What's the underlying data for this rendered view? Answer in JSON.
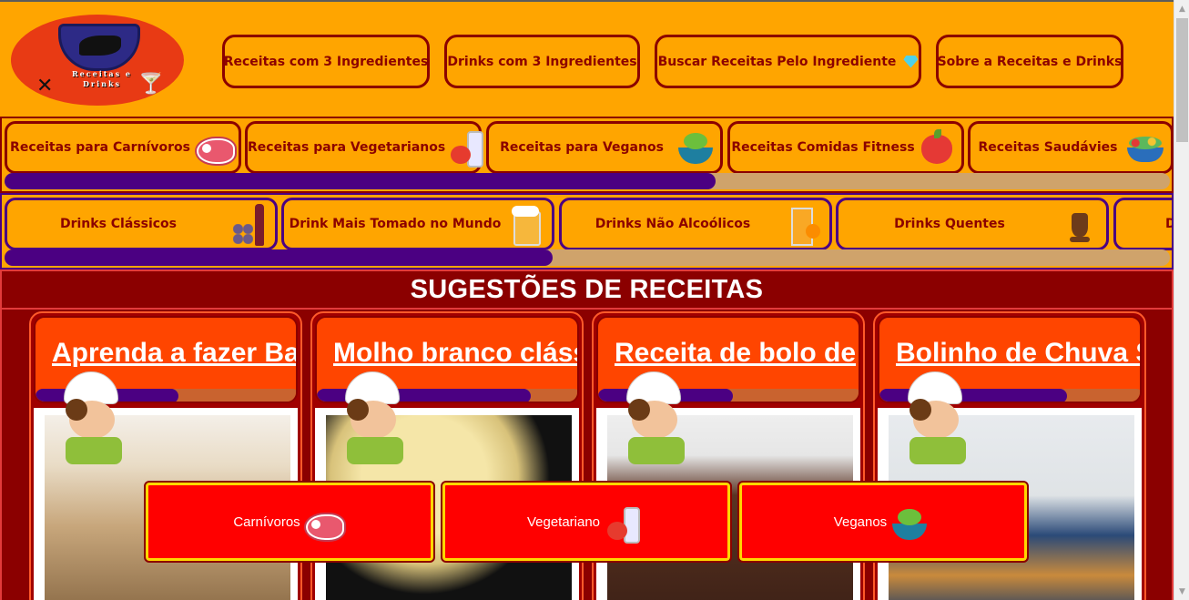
{
  "header": {
    "logo_text": "Receitas e Drinks",
    "buttons": [
      {
        "label": "Receitas com 3 Ingredientes"
      },
      {
        "label": "Drinks com 3 Ingredientes"
      },
      {
        "label": "Buscar Receitas Pelo Ingrediente",
        "icon": "diamond-icon"
      },
      {
        "label": "Sobre a Receitas e Drinks"
      }
    ]
  },
  "recipe_categories": {
    "items": [
      {
        "label": "Receitas para Carnívoros",
        "icon": "steak-icon"
      },
      {
        "label": "Receitas para Vegetarianos",
        "icon": "tomato-bottle-icon"
      },
      {
        "label": "Receitas para Veganos",
        "icon": "salad-bowl-icon"
      },
      {
        "label": "Receitas Comidas Fitness",
        "icon": "apple-measure-icon"
      },
      {
        "label": "Receitas Saudávies",
        "icon": "salad-icon"
      }
    ],
    "scroll_fraction": 0.61
  },
  "drink_categories": {
    "items": [
      {
        "label": "Drinks Clássicos",
        "icon": "wine-grapes-icon"
      },
      {
        "label": "Drink Mais Tomado no Mundo",
        "icon": "beer-mug-icon"
      },
      {
        "label": "Drinks Não Alcoólicos",
        "icon": "juice-icon"
      },
      {
        "label": "Drinks Quentes",
        "icon": "hot-chocolate-icon"
      },
      {
        "label": "D"
      }
    ],
    "scroll_fraction": 0.47
  },
  "suggestions": {
    "title": "SUGESTÕES DE RECEITAS",
    "cards": [
      {
        "title": "Aprenda a fazer Ba",
        "scroll_fraction": 0.54
      },
      {
        "title": "Molho branco cláss",
        "scroll_fraction": 0.81
      },
      {
        "title": "Receita de bolo de",
        "scroll_fraction": 0.51
      },
      {
        "title": "Bolinho de Chuva S",
        "scroll_fraction": 0.71
      }
    ]
  },
  "popup_buttons": [
    {
      "label": "Carnívoros",
      "icon": "steak-icon"
    },
    {
      "label": "Vegetariano",
      "icon": "tomato-bottle-icon"
    },
    {
      "label": "Veganos",
      "icon": "salad-bowl-icon"
    }
  ],
  "colors": {
    "header_bg": "#ffa500",
    "text_dark_red": "#8b0000",
    "accent_purple": "#4b0082",
    "section_bg": "#8b0000",
    "card_head": "#ff4500",
    "popup_red": "#ff0000",
    "popup_border": "#ffd700"
  }
}
